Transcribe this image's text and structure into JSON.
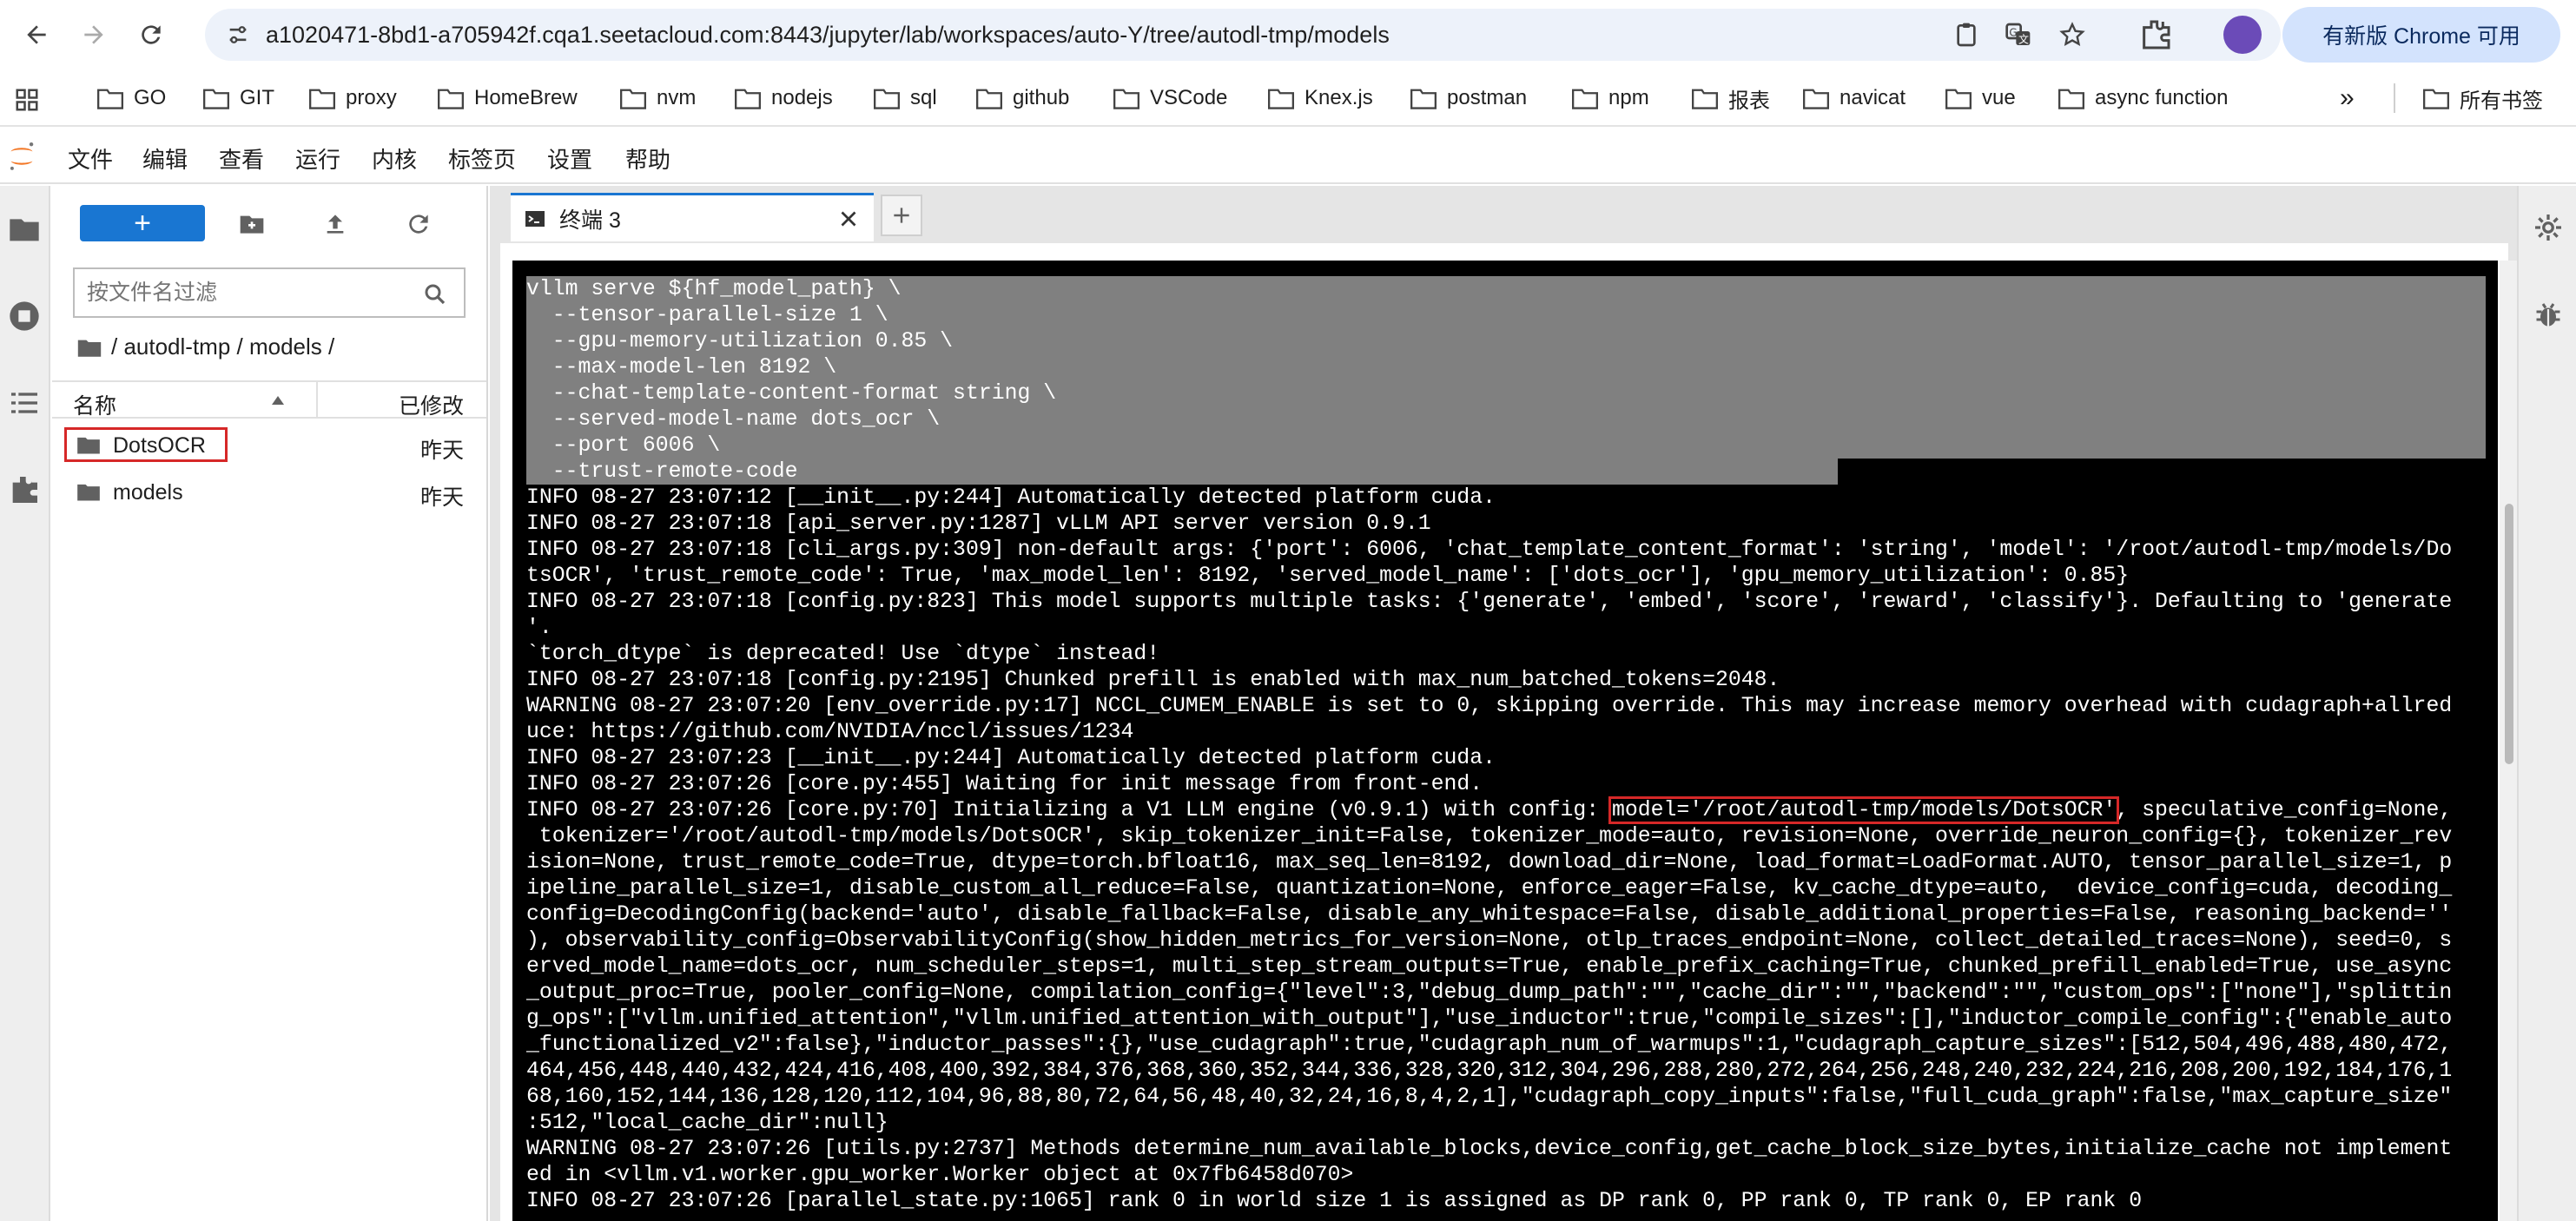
{
  "browser": {
    "url": "a1020471-8bd1-a705942f.cqa1.seetacloud.com:8443/jupyter/lab/workspaces/auto-Y/tree/autodl-tmp/models",
    "update_button": "有新版 Chrome 可用",
    "bookmarks": [
      "GO",
      "GIT",
      "proxy",
      "HomeBrew",
      "nvm",
      "nodejs",
      "sql",
      "github",
      "VSCode",
      "Knex.js",
      "postman",
      "npm",
      "报表",
      "navicat",
      "vue",
      "async function"
    ],
    "bookmarks_overflow": "»",
    "all_bookmarks": "所有书签"
  },
  "menu": [
    "文件",
    "编辑",
    "查看",
    "运行",
    "内核",
    "标签页",
    "设置",
    "帮助"
  ],
  "filebrowser": {
    "new_label": "+",
    "filter_placeholder": "按文件名过滤",
    "breadcrumb": "/ autodl-tmp / models /",
    "col_name": "名称",
    "col_modified": "已修改",
    "files": [
      {
        "name": "DotsOCR",
        "modified": "昨天"
      },
      {
        "name": "models",
        "modified": "昨天"
      }
    ]
  },
  "tabs": {
    "active": "终端 3"
  },
  "terminal": {
    "command_lines": [
      "vllm serve ${hf_model_path} \\",
      "  --tensor-parallel-size 1 \\",
      "  --gpu-memory-utilization 0.85 \\",
      "  --max-model-len 8192 \\",
      "  --chat-template-content-format string \\",
      "  --served-model-name dots_ocr \\",
      "  --port 6006 \\",
      "  --trust-remote-code"
    ],
    "output_lines": [
      "INFO 08-27 23:07:12 [__init__.py:244] Automatically detected platform cuda.",
      "INFO 08-27 23:07:18 [api_server.py:1287] vLLM API server version 0.9.1",
      "INFO 08-27 23:07:18 [cli_args.py:309] non-default args: {'port': 6006, 'chat_template_content_format': 'string', 'model': '/root/autodl-tmp/models/Do",
      "tsOCR', 'trust_remote_code': True, 'max_model_len': 8192, 'served_model_name': ['dots_ocr'], 'gpu_memory_utilization': 0.85}",
      "INFO 08-27 23:07:18 [config.py:823] This model supports multiple tasks: {'generate', 'embed', 'score', 'reward', 'classify'}. Defaulting to 'generate",
      "'.",
      "`torch_dtype` is deprecated! Use `dtype` instead!",
      "INFO 08-27 23:07:18 [config.py:2195] Chunked prefill is enabled with max_num_batched_tokens=2048.",
      "WARNING 08-27 23:07:20 [env_override.py:17] NCCL_CUMEM_ENABLE is set to 0, skipping override. This may increase memory overhead with cudagraph+allred",
      "uce: https://github.com/NVIDIA/nccl/issues/1234",
      "INFO 08-27 23:07:23 [__init__.py:244] Automatically detected platform cuda.",
      "INFO 08-27 23:07:26 [core.py:455] Waiting for init message from front-end.",
      "INFO 08-27 23:07:26 [core.py:70] Initializing a V1 LLM engine (v0.9.1) with config: model='/root/autodl-tmp/models/DotsOCR', speculative_config=None,",
      " tokenizer='/root/autodl-tmp/models/DotsOCR', skip_tokenizer_init=False, tokenizer_mode=auto, revision=None, override_neuron_config={}, tokenizer_rev",
      "ision=None, trust_remote_code=True, dtype=torch.bfloat16, max_seq_len=8192, download_dir=None, load_format=LoadFormat.AUTO, tensor_parallel_size=1, p",
      "ipeline_parallel_size=1, disable_custom_all_reduce=False, quantization=None, enforce_eager=False, kv_cache_dtype=auto,  device_config=cuda, decoding_",
      "config=DecodingConfig(backend='auto', disable_fallback=False, disable_any_whitespace=False, disable_additional_properties=False, reasoning_backend=''",
      "), observability_config=ObservabilityConfig(show_hidden_metrics_for_version=None, otlp_traces_endpoint=None, collect_detailed_traces=None), seed=0, s",
      "erved_model_name=dots_ocr, num_scheduler_steps=1, multi_step_stream_outputs=True, enable_prefix_caching=True, chunked_prefill_enabled=True, use_async",
      "_output_proc=True, pooler_config=None, compilation_config={\"level\":3,\"debug_dump_path\":\"\",\"cache_dir\":\"\",\"backend\":\"\",\"custom_ops\":[\"none\"],\"splittin",
      "g_ops\":[\"vllm.unified_attention\",\"vllm.unified_attention_with_output\"],\"use_inductor\":true,\"compile_sizes\":[],\"inductor_compile_config\":{\"enable_auto",
      "_functionalized_v2\":false},\"inductor_passes\":{},\"use_cudagraph\":true,\"cudagraph_num_of_warmups\":1,\"cudagraph_capture_sizes\":[512,504,496,488,480,472,",
      "464,456,448,440,432,424,416,408,400,392,384,376,368,360,352,344,336,328,320,312,304,296,288,280,272,264,256,248,240,232,224,216,208,200,192,184,176,1",
      "68,160,152,144,136,128,120,112,104,96,88,80,72,64,56,48,40,32,24,16,8,4,2,1],\"cudagraph_copy_inputs\":false,\"full_cuda_graph\":false,\"max_capture_size\"",
      ":512,\"local_cache_dir\":null}",
      "WARNING 08-27 23:07:26 [utils.py:2737] Methods determine_num_available_blocks,device_config,get_cache_block_size_bytes,initialize_cache not implement",
      "ed in <vllm.v1.worker.gpu_worker.Worker object at 0x7fb6458d070>",
      "INFO 08-27 23:07:26 [parallel_state.py:1065] rank 0 in world size 1 is assigned as DP rank 0, PP rank 0, TP rank 0, EP rank 0"
    ]
  },
  "colors": {
    "accent": "#1976d2",
    "highlight": "#d62828",
    "terminal_bg": "#000000"
  }
}
